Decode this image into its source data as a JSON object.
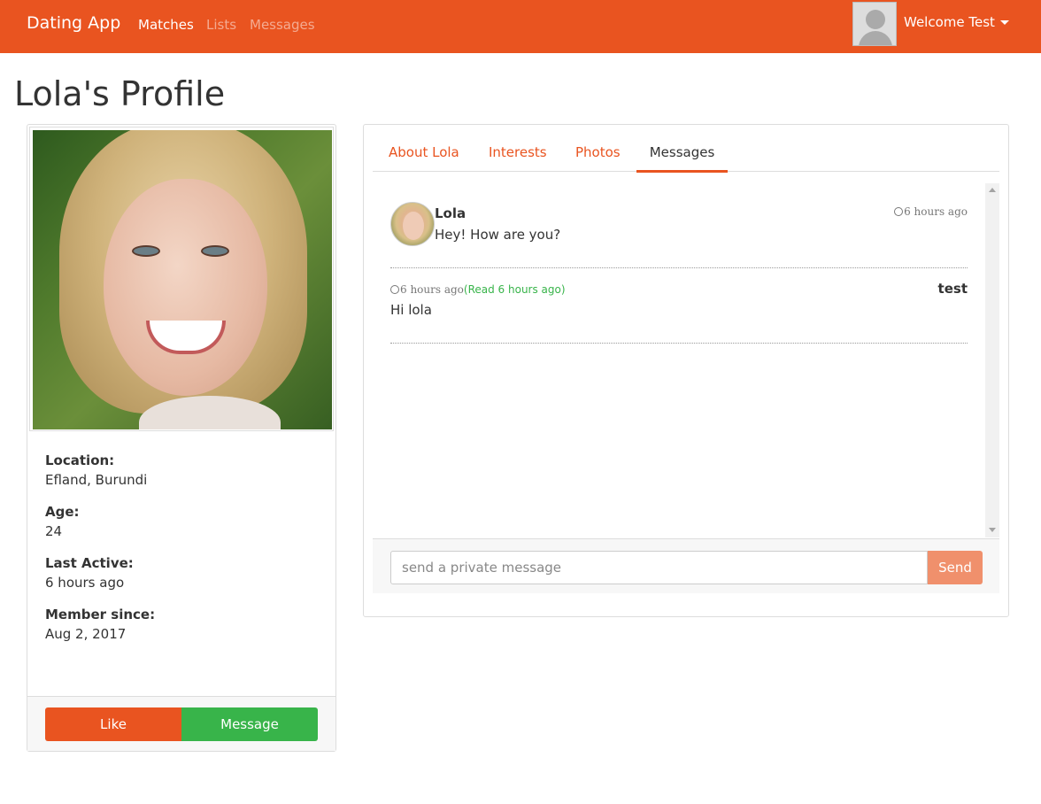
{
  "navbar": {
    "brand": "Dating App",
    "links": [
      {
        "label": "Matches",
        "active": true
      },
      {
        "label": "Lists",
        "active": false
      },
      {
        "label": "Messages",
        "active": false
      }
    ],
    "welcome": "Welcome Test",
    "accent_color": "#e95420"
  },
  "page": {
    "title": "Lola's Profile"
  },
  "profile": {
    "location_label": "Location:",
    "location": "Efland, Burundi",
    "age_label": "Age:",
    "age": "24",
    "last_active_label": "Last Active:",
    "last_active": "6 hours ago",
    "member_since_label": "Member since:",
    "member_since": "Aug 2, 2017",
    "like_button": "Like",
    "message_button": "Message"
  },
  "tabs": [
    {
      "label": "About Lola",
      "active": false
    },
    {
      "label": "Interests",
      "active": false
    },
    {
      "label": "Photos",
      "active": false
    },
    {
      "label": "Messages",
      "active": true
    }
  ],
  "messages": [
    {
      "sender": "Lola",
      "text": "Hey! How are you?",
      "time": "6 hours ago"
    },
    {
      "sender": "test",
      "text": "Hi lola",
      "time": "6 hours ago",
      "read_status": "(Read 6 hours ago)"
    }
  ],
  "composer": {
    "placeholder": "send a private message",
    "send_label": "Send"
  },
  "icons": {
    "clock": "clock-icon",
    "caret": "caret-down-icon",
    "user": "user-avatar-icon"
  },
  "colors": {
    "primary": "#e95420",
    "success": "#38b44a",
    "send_button": "#f0906c"
  }
}
